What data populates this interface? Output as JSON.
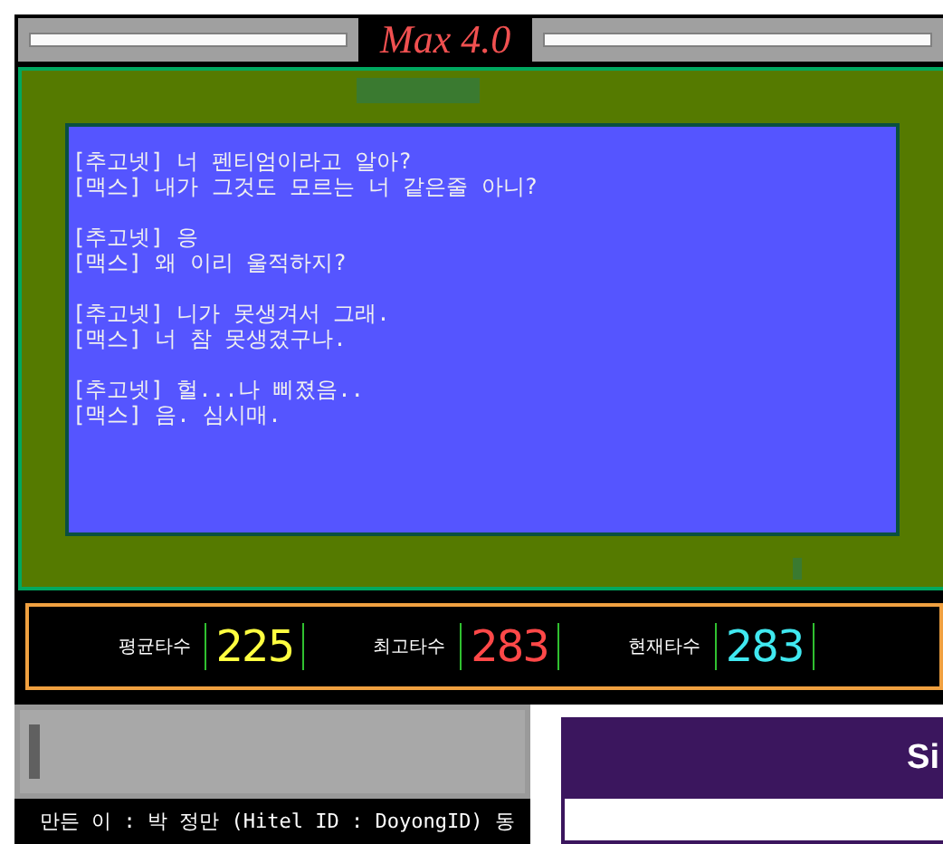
{
  "title": "Max 4.0",
  "chat": [
    {
      "lines": [
        "[추고넷] 너 펜티엄이라고 알아?",
        "[맥스] 내가 그것도 모르는 너 같은줄 아니?"
      ]
    },
    {
      "lines": [
        "[추고넷] 응",
        "[맥스] 왜 이리 울적하지?"
      ]
    },
    {
      "lines": [
        "[추고넷] 니가 못생겨서 그래.",
        "[맥스] 너 참 못생겼구나."
      ]
    },
    {
      "lines": [
        "[추고넷] 헐...나 삐졌음..",
        "[맥스] 음. 심시매."
      ]
    }
  ],
  "stats": [
    {
      "label": "평균타수",
      "value": "225",
      "color": "#ffff40"
    },
    {
      "label": "최고타수",
      "value": "283",
      "color": "#ff4848"
    },
    {
      "label": "현재타수",
      "value": "283",
      "color": "#40e8f0"
    }
  ],
  "credit": "만든 이 : 박 정만 (Hitel ID : DoyongID) 동",
  "dialog": {
    "title": "Si"
  }
}
